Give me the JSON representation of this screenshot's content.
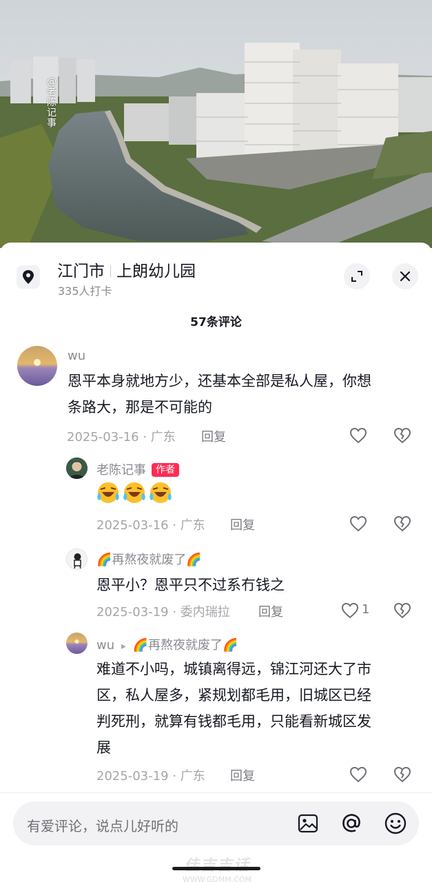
{
  "photo": {
    "watermark": "@老陈记事"
  },
  "location": {
    "city": "江门市",
    "place": "上朗幼儿园",
    "checkins": "335人打卡"
  },
  "comments_title": "57条评论",
  "comments": [
    {
      "user": "wu",
      "text_line1": "恩平本身就地方少，还基本全部是私人屋，你想",
      "text_line2": "条路大，那是不可能的",
      "meta": "2025-03-16 · 广东",
      "reply": "回复"
    },
    {
      "user": "老陈记事",
      "badge": "作者",
      "meta": "2025-03-16 · 广东",
      "reply": "回复"
    },
    {
      "user": "🌈再熬夜就废了🌈",
      "text_line1": "恩平小？恩平只不过系冇钱之",
      "meta": "2025-03-19 · 委内瑞拉",
      "reply": "回复",
      "likes": "1"
    },
    {
      "user": "wu",
      "arrow": "▸",
      "reply_to": "🌈再熬夜就废了🌈",
      "text_line1": "难道不小吗，城镇离得远，锦江河还大了市",
      "text_line2": "区，私人屋多，紧规划都毛用，旧城区已经",
      "text_line3": "判死刑，就算有钱都毛用，只能看新城区发",
      "text_line4": "展",
      "meta": "2025-03-19 · 广东",
      "reply": "回复"
    }
  ],
  "input": {
    "placeholder": "有爱评论，说点儿好听的"
  },
  "site_mark": {
    "name": "佳吉吉话",
    "url": "WWW.GDMM.COM"
  },
  "icons": {
    "location": "location-pin-icon",
    "expand": "expand-icon",
    "close": "close-icon",
    "like": "heart-icon",
    "dislike": "broken-heart-icon",
    "image": "image-icon",
    "mention": "at-icon",
    "emoji": "emoji-icon"
  },
  "colors": {
    "author_badge": "#fe2c55",
    "muted_text": "#8a8b91",
    "input_bg": "#f2f2f4"
  }
}
